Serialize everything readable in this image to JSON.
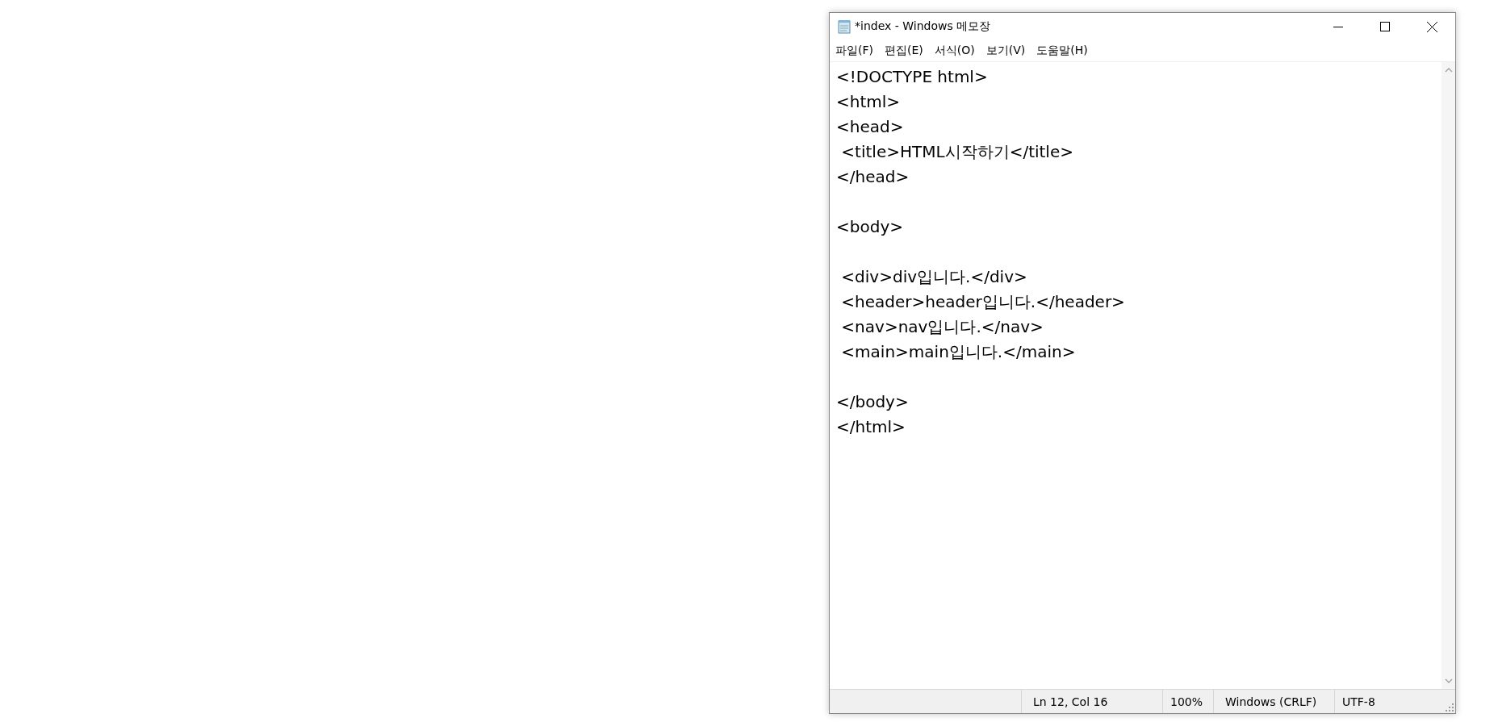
{
  "window": {
    "title": "*index - Windows 메모장"
  },
  "menu": [
    "파일(F)",
    "편집(E)",
    "서식(O)",
    "보기(V)",
    "도움말(H)"
  ],
  "editor": {
    "blocks": [
      [
        "<!DOCTYPE html>",
        "<html>",
        "<head>",
        " <title>HTML시작하기</title>",
        "</head>"
      ],
      [
        "<body>"
      ],
      [
        " <div>div입니다.</div>",
        " <header>header입니다.</header>",
        " <nav>nav입니다.</nav>",
        " <main>main입니다.</main>"
      ],
      [
        "</body>",
        "</html>"
      ]
    ]
  },
  "status_bar": [
    "Ln 12, Col 16",
    "100%",
    "Windows (CRLF)",
    "UTF-8"
  ]
}
